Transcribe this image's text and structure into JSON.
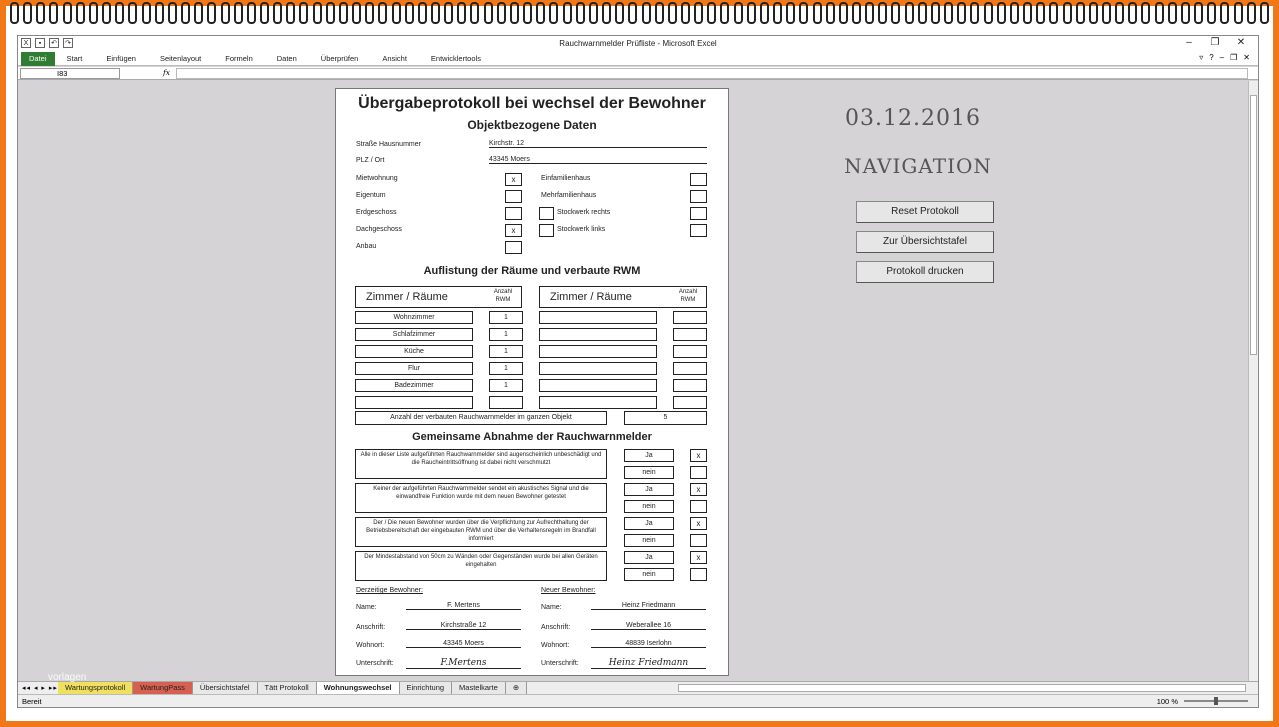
{
  "window": {
    "title": "Rauchwarnmelder Prüfliste - Microsoft Excel",
    "minimize": "–",
    "restore": "❐",
    "close": "✕"
  },
  "ribbon": {
    "tabs": [
      "Datei",
      "Start",
      "Einfügen",
      "Seitenlayout",
      "Formeln",
      "Daten",
      "Überprüfen",
      "Ansicht",
      "Entwicklertools"
    ]
  },
  "formula_bar": {
    "name_box": "I83",
    "fx": "fx",
    "value": ""
  },
  "form": {
    "title": "Übergabeprotokoll bei wechsel der Bewohner",
    "subtitle": "Objektbezogene Daten",
    "street_label": "Straße Hausnummer",
    "street_value": "Kirchstr. 12",
    "plz_label": "PLZ / Ort",
    "plz_value": "43345 Moers",
    "checks_left": [
      {
        "label": "Mietwohnung",
        "mark": "x"
      },
      {
        "label": "Eigentum",
        "mark": ""
      },
      {
        "label": "Erdgeschoss",
        "mark": ""
      },
      {
        "label": "Dachgeschoss",
        "mark": "x"
      },
      {
        "label": "Anbau",
        "mark": ""
      }
    ],
    "checks_right": [
      {
        "label": "Einfamilienhaus",
        "mark": ""
      },
      {
        "label": "Mehrfamilienhaus",
        "mark": ""
      },
      {
        "label": "Stockwerk rechts",
        "mark": ""
      },
      {
        "label": "Stockwerk links",
        "mark": ""
      }
    ],
    "rooms_title": "Auflistung der Räume und verbaute RWM",
    "rooms_header": "Zimmer / Räume",
    "count_header": "Anzahl RWM",
    "rooms": [
      {
        "name": "Wohnzimmer",
        "count": "1"
      },
      {
        "name": "Schlafzimmer",
        "count": "1"
      },
      {
        "name": "Küche",
        "count": "1"
      },
      {
        "name": "Flur",
        "count": "1"
      },
      {
        "name": "Badezimmer",
        "count": "1"
      },
      {
        "name": "",
        "count": ""
      }
    ],
    "total_label": "Anzahl der verbauten Rauchwarnmelder im ganzen Objekt",
    "total_value": "5",
    "acceptance_title": "Gemeinsame Abnahme der Rauchwarnmelder",
    "yes_label": "Ja",
    "no_label": "nein",
    "statements": [
      {
        "text": "Alle in dieser Liste aufgeführten Rauchwarnmelder sind augenscheinlich unbeschädigt und die Raucheintrittsöffnung ist dabei nicht verschmutzt",
        "yes_mark": "x",
        "no_mark": ""
      },
      {
        "text": "Keiner der aufgeführten Rauchwarnmelder sendet ein akustisches Signal und die einwandfreie Funktion wurde mit dem neuen Bewohner getestet",
        "yes_mark": "x",
        "no_mark": ""
      },
      {
        "text": "Der / Die neuen Bewohner wurden über die Verpflichtung zur Aufrechthaltung der Betriebsbereitschaft der eingebauten RWM und über die Verhaltensregeln im Brandfall informiert",
        "yes_mark": "x",
        "no_mark": ""
      },
      {
        "text": "Der Mindestabstand von 50cm zu Wänden oder Gegenständen wurde bei allen Geräten eingehalten",
        "yes_mark": "x",
        "no_mark": ""
      }
    ],
    "current_resident": {
      "heading": "Derzeitige Bewohner:",
      "name_label": "Name:",
      "name": "F. Mertens",
      "address_label": "Anschrift:",
      "address": "Kirchstraße 12",
      "city_label": "Wohnort:",
      "city": "43345 Moers",
      "signature_label": "Unterschrift:",
      "signature": "F.Mertens"
    },
    "new_resident": {
      "heading": "Neuer Bewohner:",
      "name_label": "Name:",
      "name": "Heinz Friedmann",
      "address_label": "Anschrift:",
      "address": "Weberallee 16",
      "city_label": "Wohnort:",
      "city": "48839 Iserlohn",
      "signature_label": "Unterschrift:",
      "signature": "Heinz Friedmann"
    }
  },
  "side": {
    "date": "03.12.2016",
    "nav_title": "NAVIGATION",
    "buttons": [
      "Reset Protokoll",
      "Zur Übersichtstafel",
      "Protokoll drucken"
    ]
  },
  "sheet_tabs": {
    "tabs": [
      "Wartungsprotokoll",
      "WartungPass",
      "Übersichtstafel",
      "Tätt Protokoll",
      "Wohnungswechsel",
      "Einrichtung",
      "Mastelkarte"
    ],
    "active": "Wohnungswechsel"
  },
  "status": {
    "ready": "Bereit",
    "zoom": "100 %"
  },
  "watermark": "vorlagen"
}
